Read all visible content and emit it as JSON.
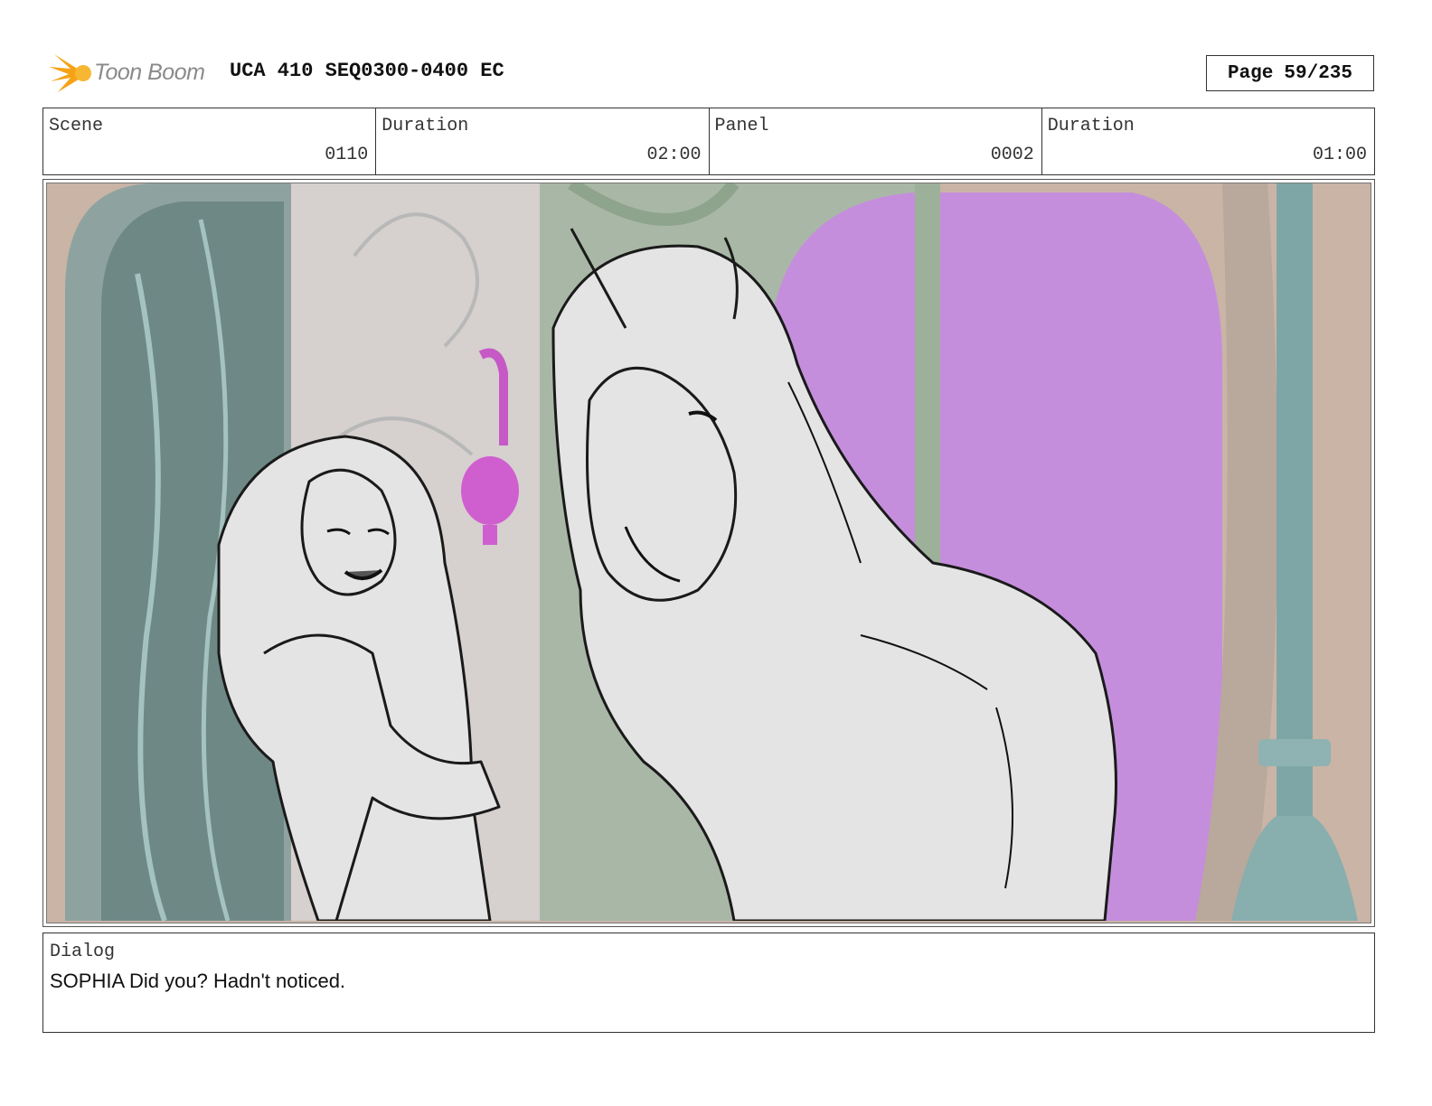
{
  "header": {
    "logo_text": "Toon Boom",
    "title": "UCA 410 SEQ0300-0400 EC",
    "page_label": "Page",
    "page_value": "59/235"
  },
  "info": {
    "scene": {
      "label": "Scene",
      "value": "0110"
    },
    "scene_duration": {
      "label": "Duration",
      "value": "02:00"
    },
    "panel": {
      "label": "Panel",
      "value": "0002"
    },
    "panel_duration": {
      "label": "Duration",
      "value": "01:00"
    }
  },
  "dialog": {
    "label": "Dialog",
    "text": "SOPHIA Did you? Hadn't noticed."
  },
  "colors": {
    "logo_orange": "#f5a316",
    "background_pink_wall": "#c9b4a6",
    "doorway_magenta": "#c58edc",
    "teal_pillar": "#7fa6a6",
    "sketch_fill": "#e4e4e4"
  }
}
